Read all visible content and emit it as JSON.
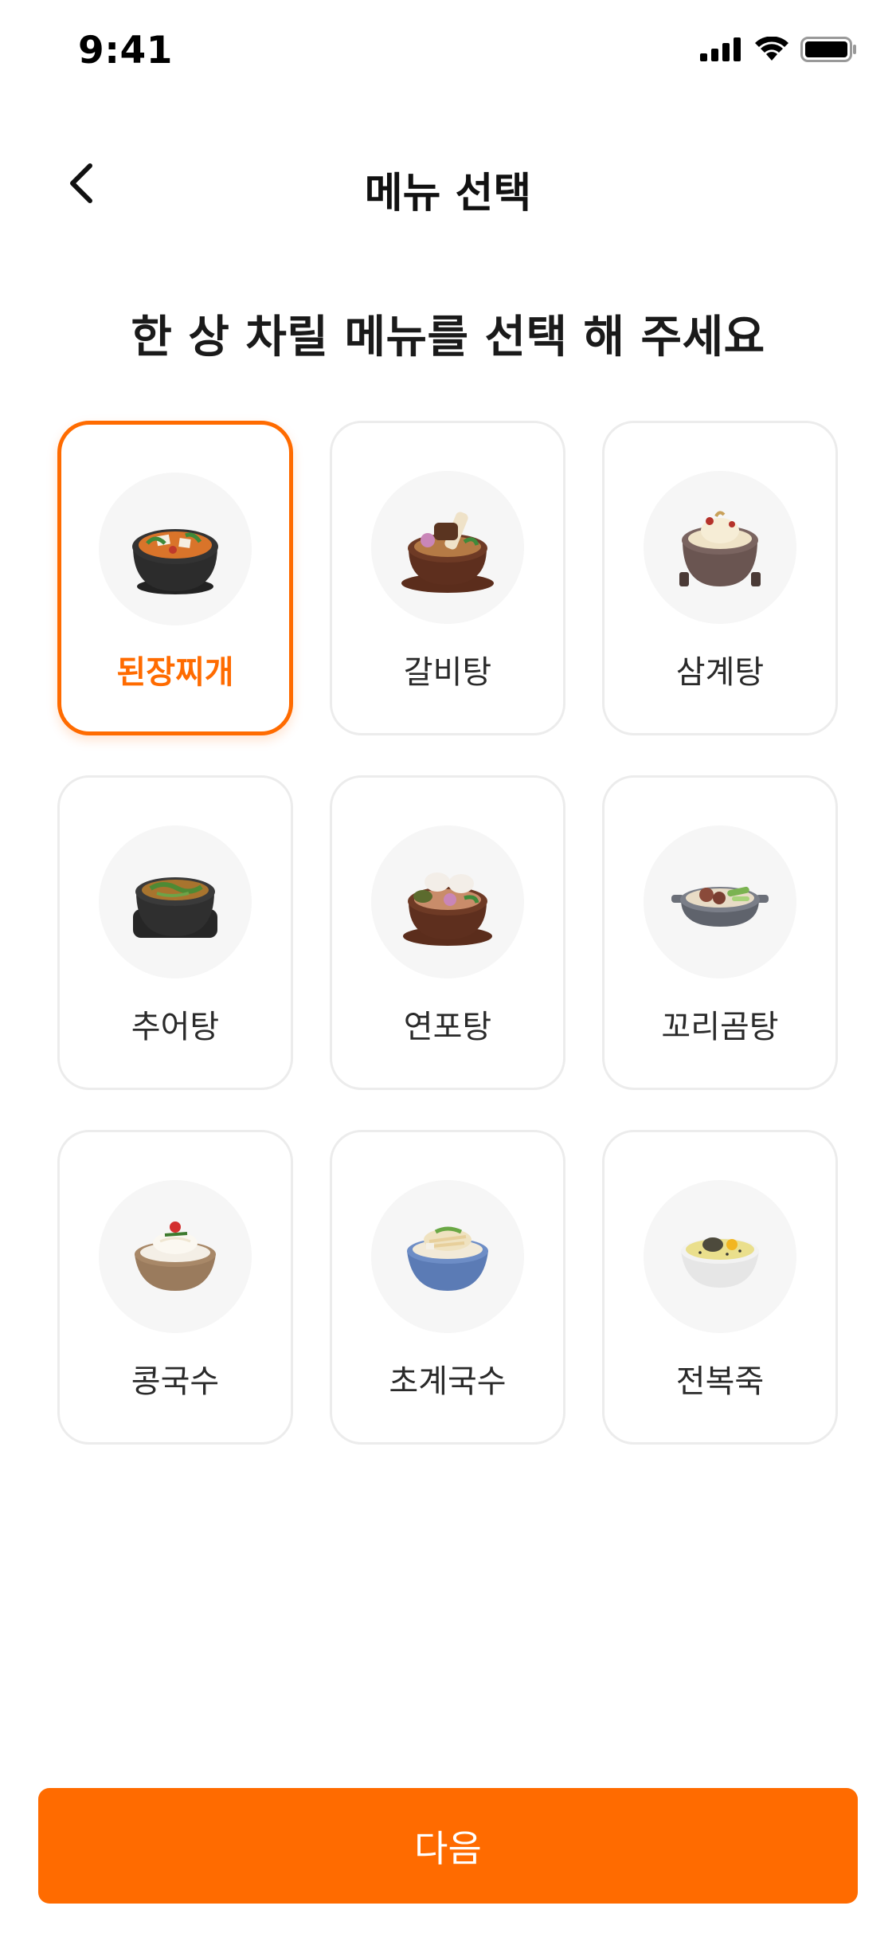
{
  "status_bar": {
    "time": "9:41",
    "icons": [
      "cellular-signal-icon",
      "wifi-icon",
      "battery-icon"
    ]
  },
  "nav": {
    "back_icon": "chevron-left-icon",
    "title": "메뉴 선택"
  },
  "heading": "한 상 차릴 메뉴를 선택 해 주세요",
  "accent_color": "#ff6b00",
  "menu_items": [
    {
      "label": "된장찌개",
      "selected": true,
      "icon": "doenjang-jjigae-icon"
    },
    {
      "label": "갈비탕",
      "selected": false,
      "icon": "galbitang-icon"
    },
    {
      "label": "삼계탕",
      "selected": false,
      "icon": "samgyetang-icon"
    },
    {
      "label": "추어탕",
      "selected": false,
      "icon": "chueotang-icon"
    },
    {
      "label": "연포탕",
      "selected": false,
      "icon": "yeonpotang-icon"
    },
    {
      "label": "꼬리곰탕",
      "selected": false,
      "icon": "kkorigomtang-icon"
    },
    {
      "label": "콩국수",
      "selected": false,
      "icon": "kongguksu-icon"
    },
    {
      "label": "초계국수",
      "selected": false,
      "icon": "chogyeguksu-icon"
    },
    {
      "label": "전복죽",
      "selected": false,
      "icon": "jeonbokjuk-icon"
    }
  ],
  "next_button": {
    "label": "다음"
  }
}
